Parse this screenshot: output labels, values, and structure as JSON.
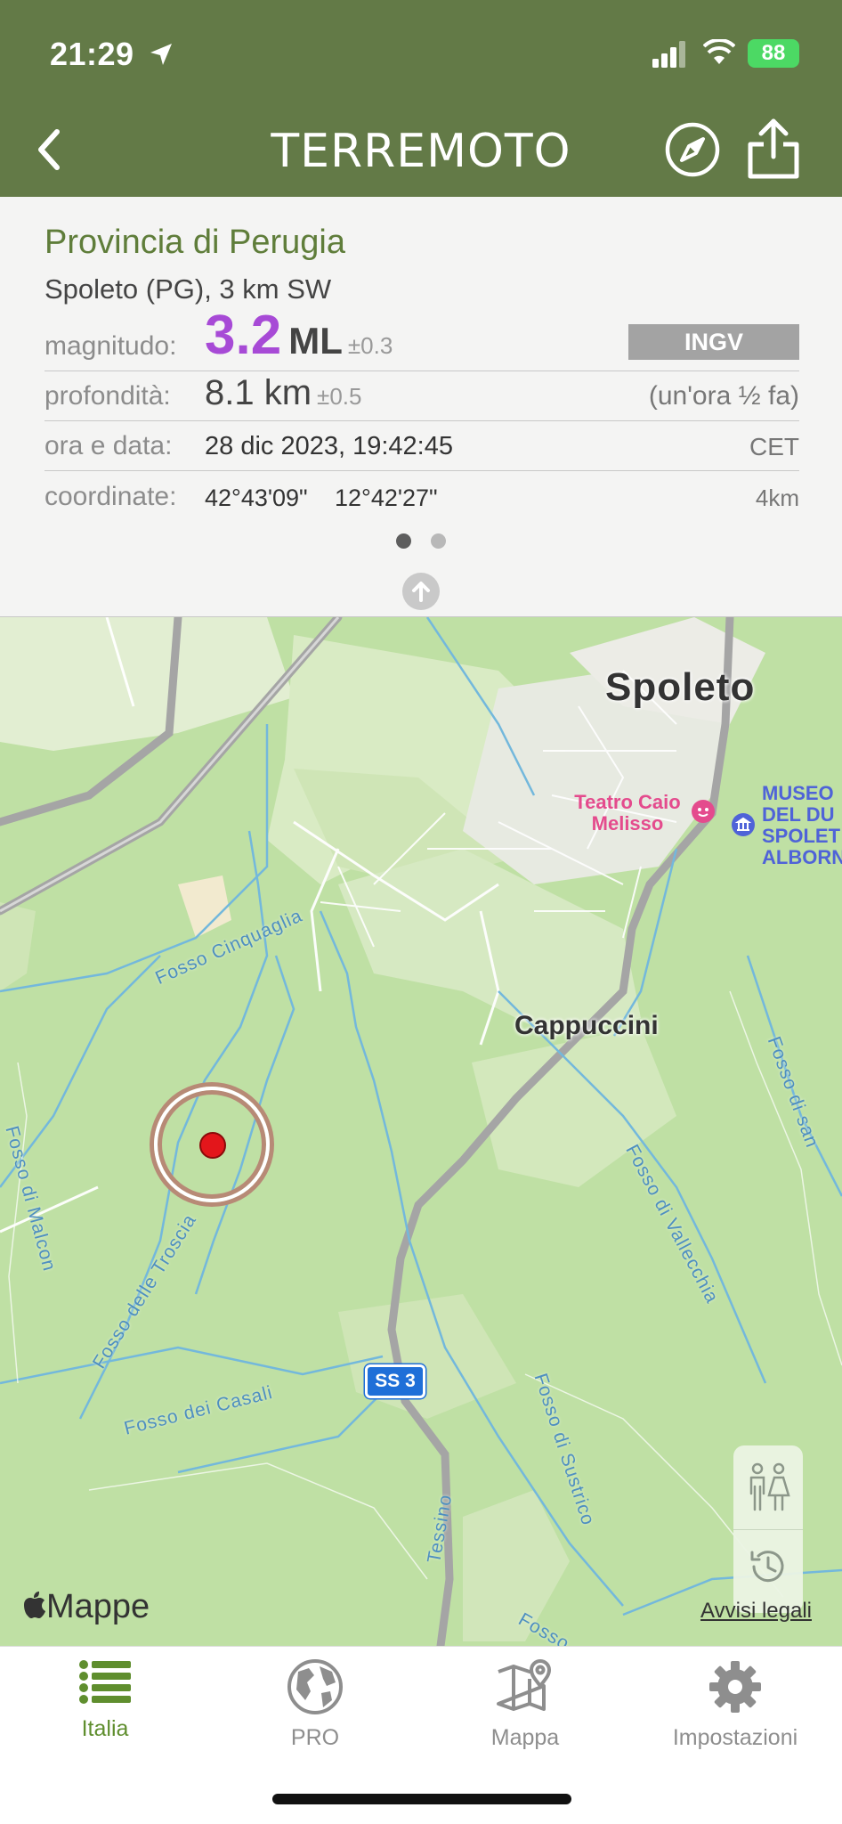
{
  "status_bar": {
    "time": "21:29",
    "battery": "88"
  },
  "header": {
    "title": "TERREMOTO",
    "back_icon": "chevron-left-icon",
    "compass_icon": "compass-icon",
    "share_icon": "share-icon"
  },
  "info": {
    "province": "Provincia di Perugia",
    "place": "Spoleto (PG), 3 km SW",
    "magnitude": {
      "label": "magnitudo:",
      "value": "3.2",
      "unit": "ML",
      "error": "±0.3",
      "source": "INGV"
    },
    "depth": {
      "label": "profondità:",
      "value": "8.1 km",
      "error": "±0.5",
      "ago": "(un'ora ½ fa)"
    },
    "datetime": {
      "label": "ora e data:",
      "value": "28 dic 2023, 19:42:45",
      "tz": "CET"
    },
    "coords": {
      "label": "coordinate:",
      "lat": "42°43'09\"",
      "lon": "12°42'27\"",
      "distance": "4km"
    }
  },
  "map": {
    "labels": {
      "city": "Spoleto",
      "district": "Cappuccini",
      "poi_theatre": "Teatro Caio Melisso",
      "poi_museum": "MUSEO DEL DU SPOLET ALBORN",
      "road": "SS 3",
      "streams": [
        "Fosso Cinquaglia",
        "Fosso delle Troscia",
        "Fosso dei Casali",
        "Fosso di Vallecchia",
        "Fosso di Sustrico",
        "Fosso di Malcon",
        "Fosso di san",
        "Tessino",
        "Fosso"
      ]
    },
    "attribution": "Mappe",
    "legal": "Avvisi legali"
  },
  "tabs": [
    {
      "label": "Italia",
      "icon": "list-icon",
      "active": true
    },
    {
      "label": "PRO",
      "icon": "globe-icon",
      "active": false
    },
    {
      "label": "Mappa",
      "icon": "map-pin-icon",
      "active": false
    },
    {
      "label": "Impostazioni",
      "icon": "gear-icon",
      "active": false
    }
  ],
  "colors": {
    "header_bg": "#637a47",
    "accent_green": "#5f8e2e",
    "magnitude": "#a74ad6",
    "epicenter": "#e3161b"
  }
}
